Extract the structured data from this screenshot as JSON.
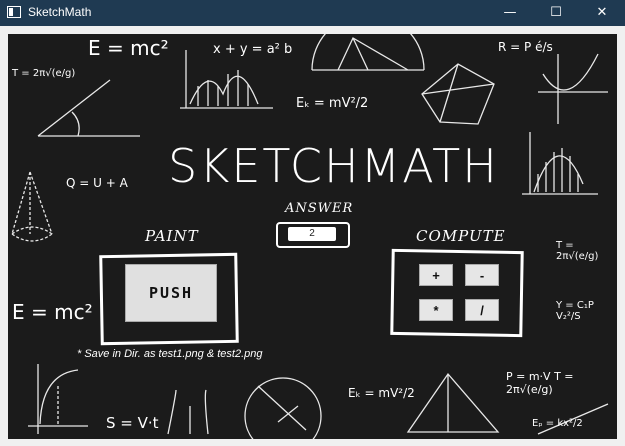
{
  "window": {
    "title": "SketchMath",
    "minimize_glyph": "—",
    "maximize_glyph": "☐",
    "close_glyph": "✕"
  },
  "app": {
    "logo_text": "SKETCHMATH",
    "paint_label": "PAINT",
    "answer_label": "ANSWER",
    "answer_value": "2",
    "compute_label": "COMPUTE",
    "push_label": "PUSH",
    "operators": [
      "+",
      "-",
      "*",
      "/"
    ],
    "save_note": "* Save in Dir. as test1.png & test2.png"
  },
  "background_formulas": {
    "f1": "E = mc²",
    "f2": "x + y = a² b",
    "f3": "R = P é/s",
    "f4": "T = 2π√(e/g)",
    "f5": "Eₖ = mV²/2",
    "f6": "Q = U + A",
    "f7": "E = mc²",
    "f8": "T = 2π√(e/g)",
    "f9": "Y = C₁P V₂²/S",
    "f10": "S = V·t",
    "f11": "Eₖ = mV²/2",
    "f12": "P = m·V  T = 2π√(e/g)",
    "f13": "Eₚ = kx²/2"
  }
}
